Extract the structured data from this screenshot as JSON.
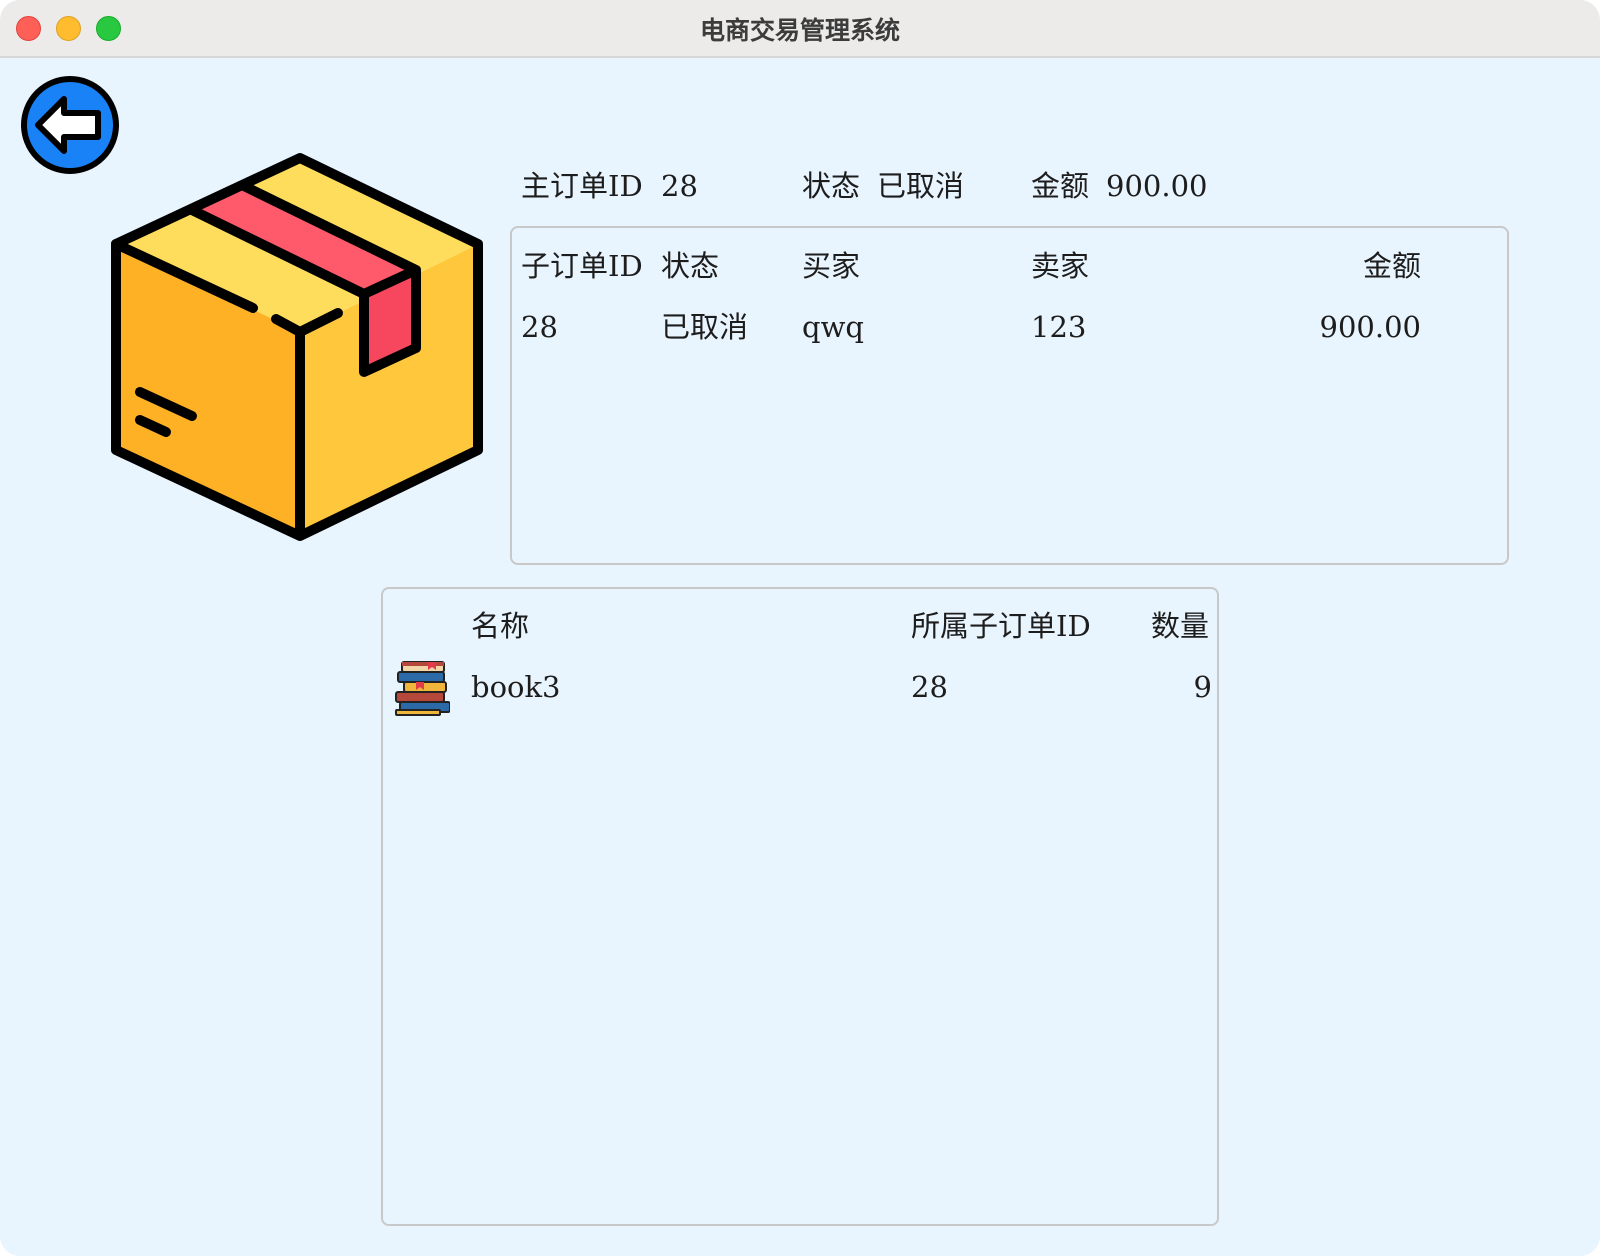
{
  "window": {
    "title": "电商交易管理系统"
  },
  "icons": {
    "back": "back-arrow-icon",
    "package": "package-box-icon",
    "book": "books-stack-icon"
  },
  "main_order": {
    "id_label": "主订单ID",
    "id_value": "28",
    "status_label": "状态",
    "status_value": "已取消",
    "amount_label": "金额",
    "amount_value": "900.00"
  },
  "sub_orders": {
    "columns": [
      "子订单ID",
      "状态",
      "买家",
      "卖家",
      "金额"
    ],
    "rows": [
      {
        "id": "28",
        "status": "已取消",
        "buyer": "qwq",
        "seller": "123",
        "amount": "900.00"
      }
    ]
  },
  "items": {
    "columns": [
      "名称",
      "所属子订单ID",
      "数量"
    ],
    "rows": [
      {
        "name": "book3",
        "sub_order_id": "28",
        "quantity": "9"
      }
    ]
  },
  "colors": {
    "background": "#e8f4fe",
    "back_button": "#1a82f7",
    "box_front": "#ffb125",
    "box_side": "#ffc73c",
    "box_top": "#ffdd5c",
    "tape": "#f6475e"
  }
}
